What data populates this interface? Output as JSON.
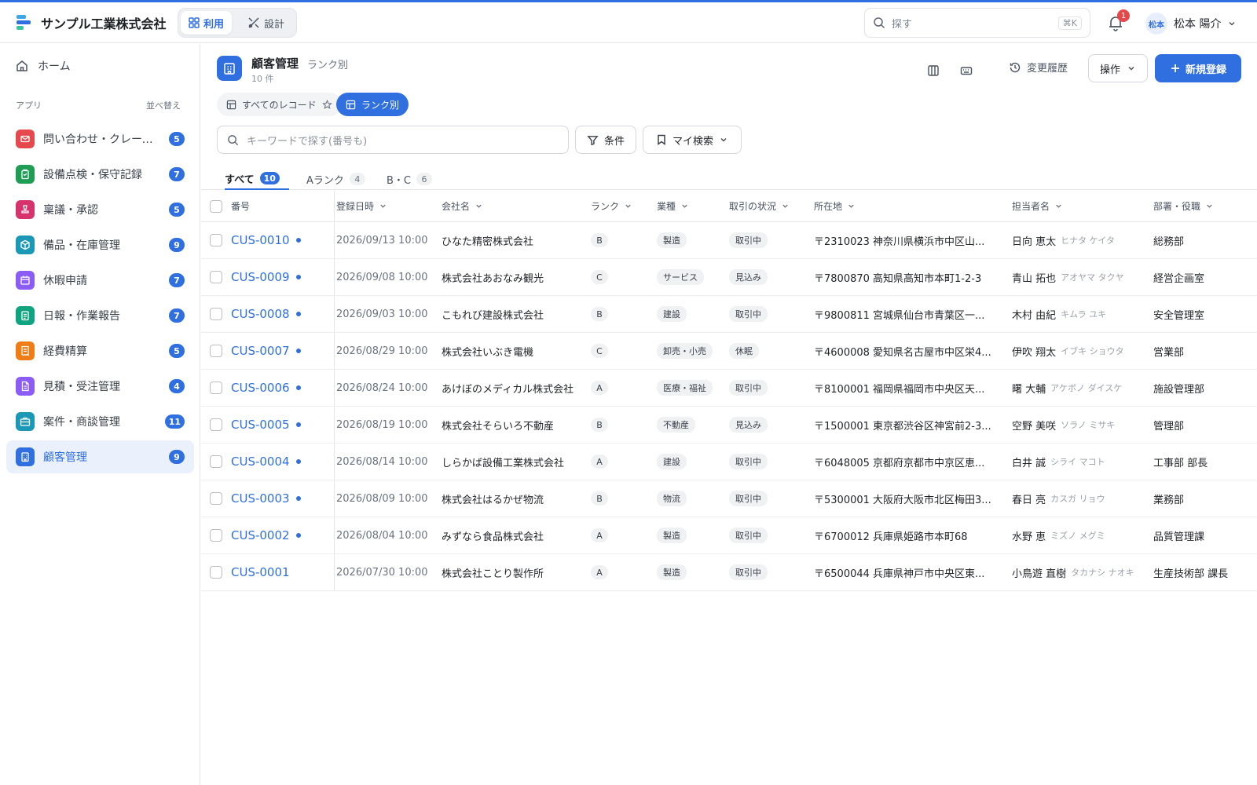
{
  "header": {
    "company": "サンプル工業株式会社",
    "mode_use": "利用",
    "mode_design": "設計",
    "search_placeholder": "探す",
    "shortcut": "⌘K",
    "notification_count": "1",
    "user_avatar": "松本",
    "user_name": "松本 陽介"
  },
  "sidebar": {
    "home": "ホーム",
    "section_label": "アプリ",
    "sort_label": "並べ替え",
    "items": [
      {
        "label": "問い合わせ・クレーム管理",
        "count": "5",
        "color": "#e5484d",
        "icon": "mail-icon"
      },
      {
        "label": "設備点検・保守記録",
        "count": "7",
        "color": "#1f9d55",
        "icon": "clipboard-icon"
      },
      {
        "label": "稟議・承認",
        "count": "5",
        "color": "#d6336c",
        "icon": "stamp-icon"
      },
      {
        "label": "備品・在庫管理",
        "count": "9",
        "color": "#1a98b5",
        "icon": "box-icon"
      },
      {
        "label": "休暇申請",
        "count": "7",
        "color": "#8b5cf6",
        "icon": "calendar-icon"
      },
      {
        "label": "日報・作業報告",
        "count": "7",
        "color": "#10a37f",
        "icon": "report-icon"
      },
      {
        "label": "経費精算",
        "count": "5",
        "color": "#f07c16",
        "icon": "receipt-icon"
      },
      {
        "label": "見積・受注管理",
        "count": "4",
        "color": "#8b5cf6",
        "icon": "document-icon"
      },
      {
        "label": "案件・商談管理",
        "count": "11",
        "color": "#1a98b5",
        "icon": "briefcase-icon"
      },
      {
        "label": "顧客管理",
        "count": "9",
        "color": "#2f6fe0",
        "icon": "building-icon"
      }
    ]
  },
  "page": {
    "title": "顧客管理",
    "subtitle": "ランク別",
    "count": "10 件",
    "history": "変更履歴",
    "ops": "操作",
    "new": "新規登録",
    "view_all": "すべてのレコード",
    "view_rank": "ランク別",
    "keyword_placeholder": "キーワードで探す(番号も)",
    "condition": "条件",
    "my_search": "マイ検索"
  },
  "tabs": [
    {
      "label": "すべて",
      "count": "10"
    },
    {
      "label": "Aランク",
      "count": "4"
    },
    {
      "label": "B・C",
      "count": "6"
    }
  ],
  "columns": [
    "番号",
    "登録日時",
    "会社名",
    "ランク",
    "業種",
    "取引の状況",
    "所在地",
    "担当者名",
    "部署・役職"
  ],
  "rows": [
    {
      "id": "CUS-0010",
      "date": "2026/09/13 10:00",
      "company": "ひなた精密株式会社",
      "rank": "B",
      "industry": "製造",
      "status": "取引中",
      "address": "〒2310023 神奈川県横浜市中区山...",
      "person": "日向 恵太",
      "kana": "ヒナタ ケイタ",
      "dept": "総務部",
      "dot": true
    },
    {
      "id": "CUS-0009",
      "date": "2026/09/08 10:00",
      "company": "株式会社あおなみ観光",
      "rank": "C",
      "industry": "サービス",
      "status": "見込み",
      "address": "〒7800870 高知県高知市本町1-2-3",
      "person": "青山 拓也",
      "kana": "アオヤマ タクヤ",
      "dept": "経営企画室",
      "dot": true
    },
    {
      "id": "CUS-0008",
      "date": "2026/09/03 10:00",
      "company": "こもれび建設株式会社",
      "rank": "B",
      "industry": "建設",
      "status": "取引中",
      "address": "〒9800811 宮城県仙台市青葉区一...",
      "person": "木村 由紀",
      "kana": "キムラ ユキ",
      "dept": "安全管理室",
      "dot": true
    },
    {
      "id": "CUS-0007",
      "date": "2026/08/29 10:00",
      "company": "株式会社いぶき電機",
      "rank": "C",
      "industry": "卸売・小売",
      "status": "休眠",
      "address": "〒4600008 愛知県名古屋市中区栄4...",
      "person": "伊吹 翔太",
      "kana": "イブキ ショウタ",
      "dept": "営業部",
      "dot": true
    },
    {
      "id": "CUS-0006",
      "date": "2026/08/24 10:00",
      "company": "あけぼのメディカル株式会社",
      "rank": "A",
      "industry": "医療・福祉",
      "status": "取引中",
      "address": "〒8100001 福岡県福岡市中央区天...",
      "person": "曙 大輔",
      "kana": "アケボノ ダイスケ",
      "dept": "施設管理部",
      "dot": true
    },
    {
      "id": "CUS-0005",
      "date": "2026/08/19 10:00",
      "company": "株式会社そらいろ不動産",
      "rank": "B",
      "industry": "不動産",
      "status": "見込み",
      "address": "〒1500001 東京都渋谷区神宮前2-3...",
      "person": "空野 美咲",
      "kana": "ソラノ ミサキ",
      "dept": "管理部",
      "dot": true
    },
    {
      "id": "CUS-0004",
      "date": "2026/08/14 10:00",
      "company": "しらかば設備工業株式会社",
      "rank": "A",
      "industry": "建設",
      "status": "取引中",
      "address": "〒6048005 京都府京都市中京区恵...",
      "person": "白井 誠",
      "kana": "シライ マコト",
      "dept": "工事部 部長",
      "dot": true
    },
    {
      "id": "CUS-0003",
      "date": "2026/08/09 10:00",
      "company": "株式会社はるかぜ物流",
      "rank": "B",
      "industry": "物流",
      "status": "取引中",
      "address": "〒5300001 大阪府大阪市北区梅田3...",
      "person": "春日 亮",
      "kana": "カスガ リョウ",
      "dept": "業務部",
      "dot": true
    },
    {
      "id": "CUS-0002",
      "date": "2026/08/04 10:00",
      "company": "みずなら食品株式会社",
      "rank": "A",
      "industry": "製造",
      "status": "取引中",
      "address": "〒6700012 兵庫県姫路市本町68",
      "person": "水野 恵",
      "kana": "ミズノ メグミ",
      "dept": "品質管理課",
      "dot": true
    },
    {
      "id": "CUS-0001",
      "date": "2026/07/30 10:00",
      "company": "株式会社ことり製作所",
      "rank": "A",
      "industry": "製造",
      "status": "取引中",
      "address": "〒6500044 兵庫県神戸市中央区東...",
      "person": "小鳥遊 直樹",
      "kana": "タカナシ ナオキ",
      "dept": "生産技術部 課長",
      "dot": false
    }
  ]
}
